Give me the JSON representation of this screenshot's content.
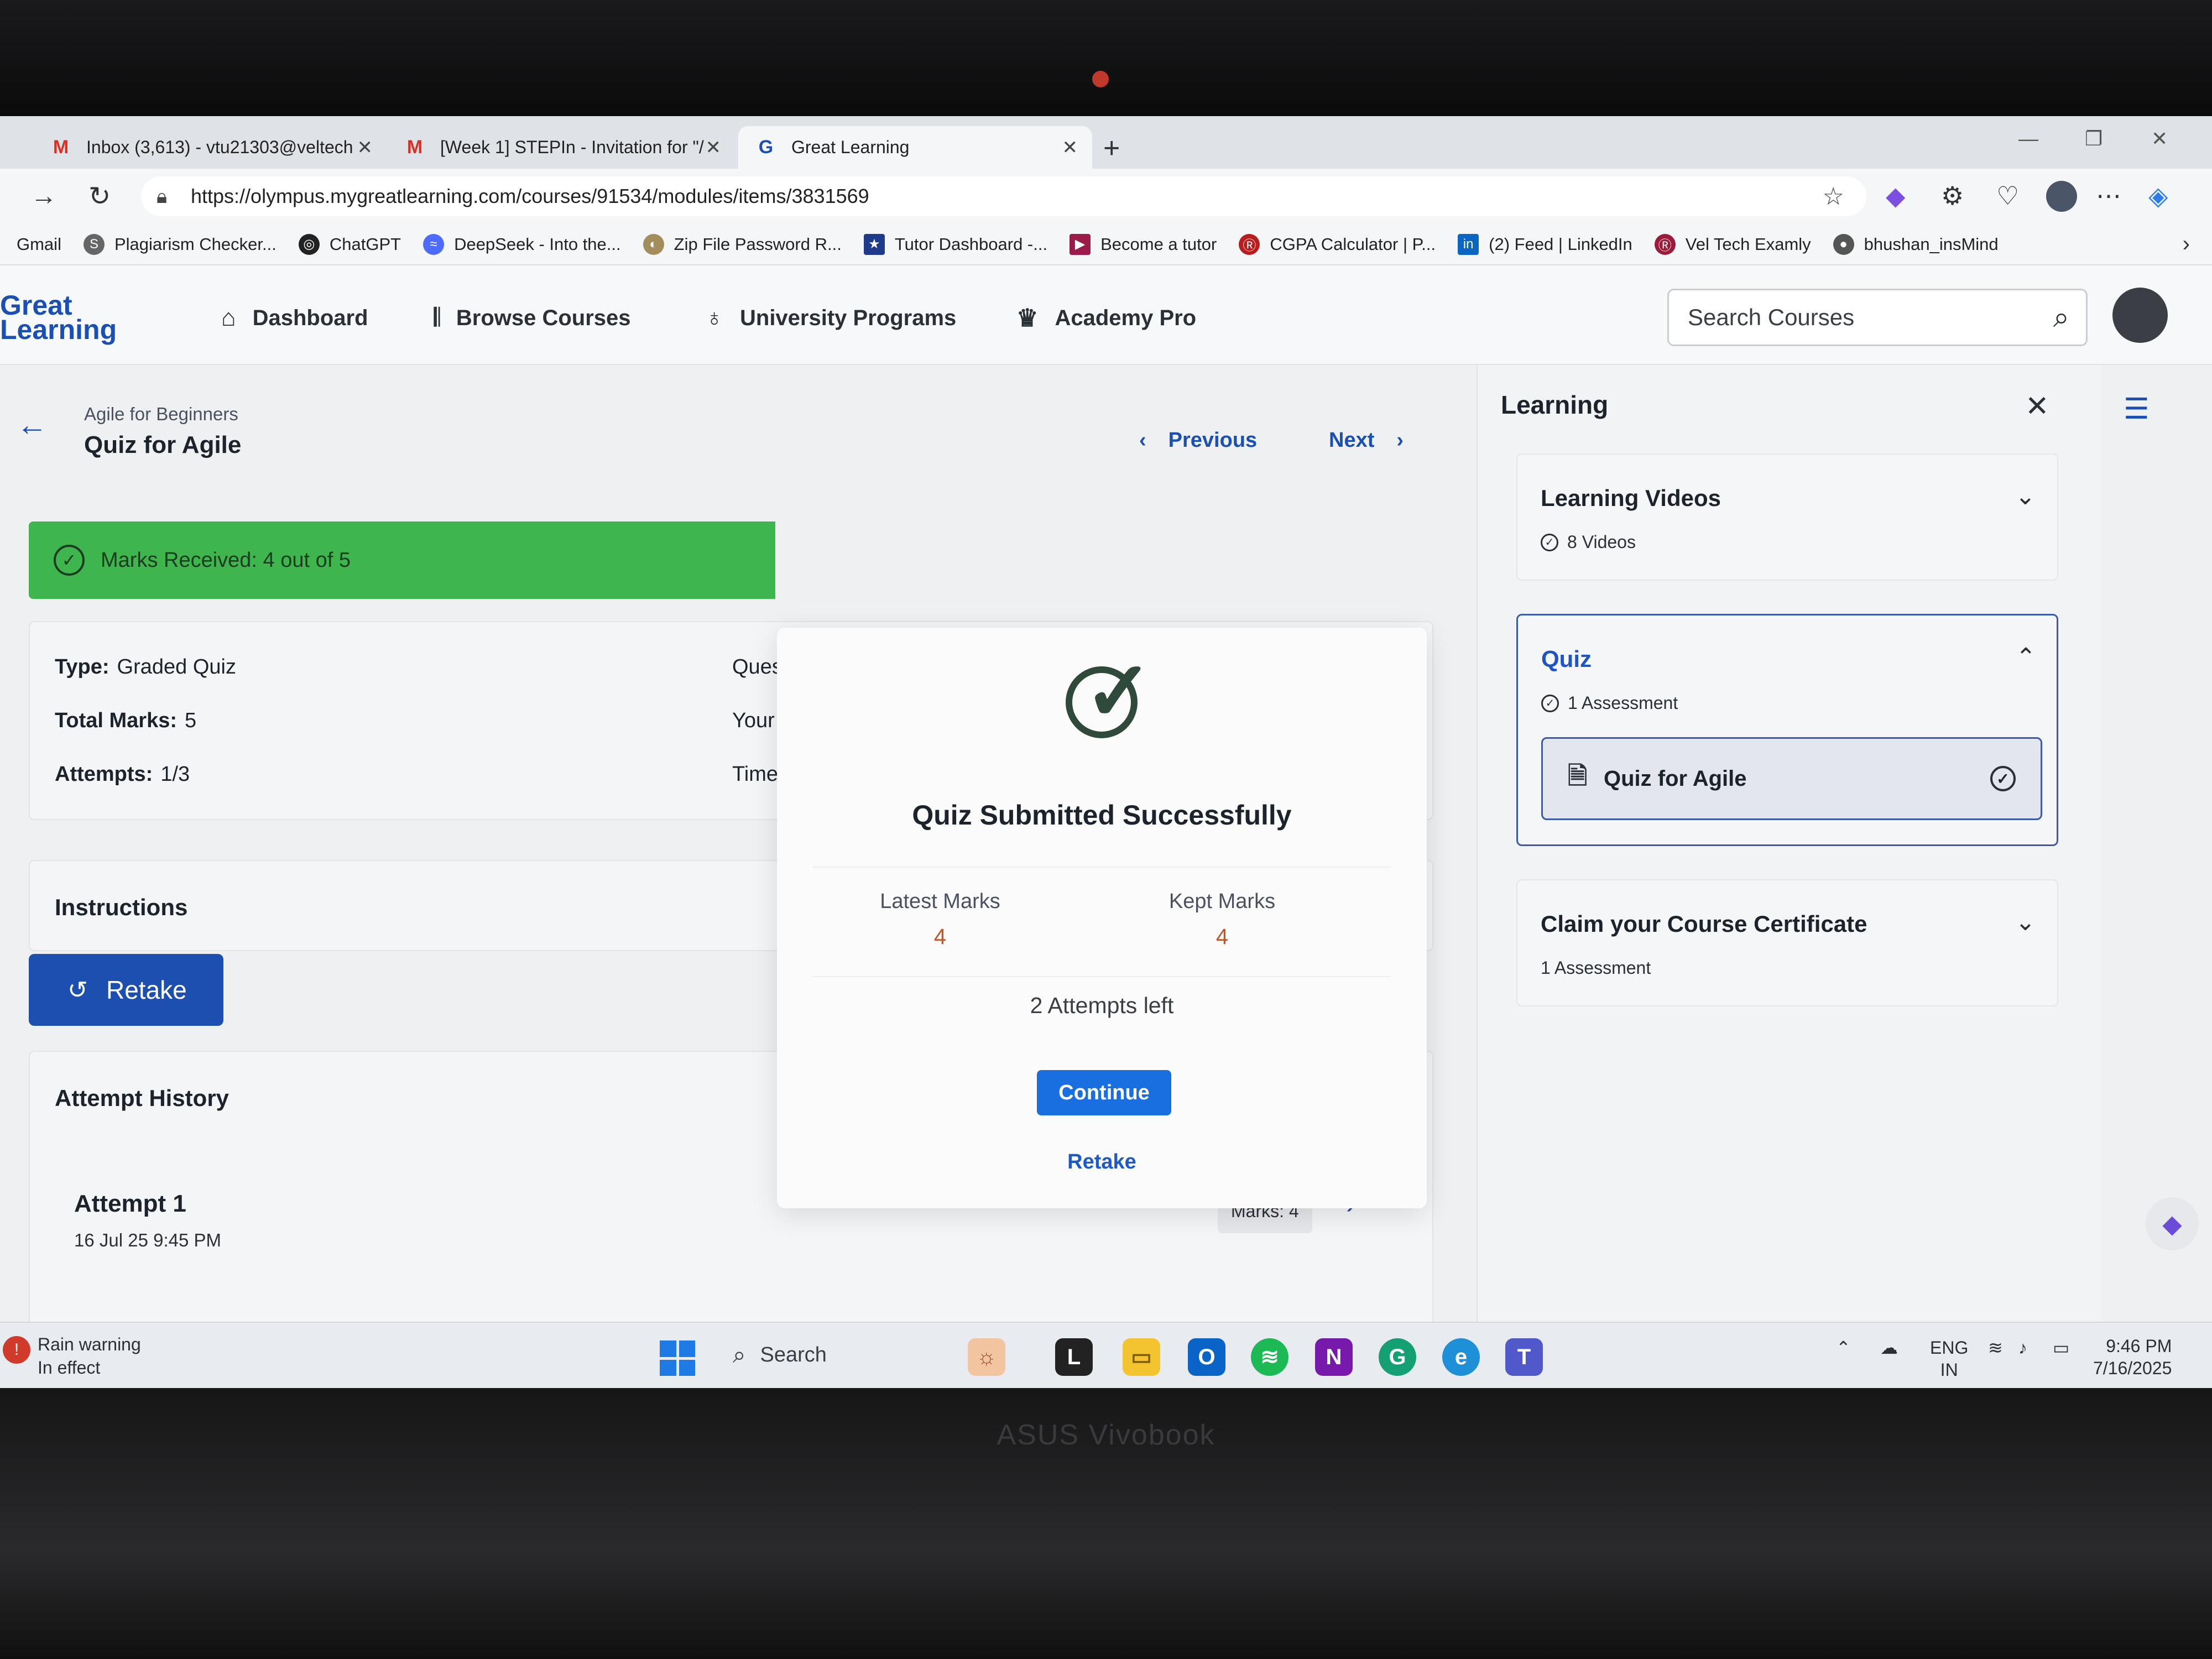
{
  "device": {
    "brand": "ASUS Vivobook"
  },
  "browser": {
    "tabs": [
      {
        "label": "Inbox (3,613) - vtu21303@veltech",
        "icon": "gmail-icon"
      },
      {
        "label": "[Week 1] STEPIn - Invitation for \"/",
        "icon": "gmail-icon"
      },
      {
        "label": "Great Learning",
        "icon": "great-learning-icon"
      }
    ],
    "url": "https://olympus.mygreatlearning.com/courses/91534/modules/items/3831569",
    "bookmarks": [
      {
        "label": "Gmail"
      },
      {
        "label": "Plagiarism Checker..."
      },
      {
        "label": "ChatGPT"
      },
      {
        "label": "DeepSeek - Into the..."
      },
      {
        "label": "Zip File Password R..."
      },
      {
        "label": "Tutor Dashboard -..."
      },
      {
        "label": "Become a tutor"
      },
      {
        "label": "CGPA Calculator | P..."
      },
      {
        "label": "(2) Feed | LinkedIn"
      },
      {
        "label": "Vel Tech Examly"
      },
      {
        "label": "bhushan_insMind"
      }
    ]
  },
  "header": {
    "logo_line1": "Great",
    "logo_line2": "Learning",
    "nav": [
      {
        "label": "Dashboard",
        "icon": "home-icon"
      },
      {
        "label": "Browse Courses",
        "icon": "library-icon"
      },
      {
        "label": "University Programs",
        "icon": "award-icon"
      },
      {
        "label": "Academy Pro",
        "icon": "crown-icon"
      }
    ],
    "search_placeholder": "Search Courses"
  },
  "main": {
    "breadcrumb": "Agile for Beginners",
    "title": "Quiz for Agile",
    "previous_label": "Previous",
    "next_label": "Next",
    "marks_banner": "Marks Received: 4 out of 5",
    "info": {
      "type_label": "Type:",
      "type_value": "Graded Quiz",
      "total_label": "Total Marks:",
      "total_value": "5",
      "attempts_label": "Attempts:",
      "attempts_value": "1/3",
      "col2_row1": "Ques",
      "col2_row2": "Your",
      "col2_row3": "Time"
    },
    "instructions_label": "Instructions",
    "retake_label": "Retake",
    "history": {
      "title": "Attempt History",
      "attempt_title": "Attempt 1",
      "attempt_date": "16 Jul 25 9:45 PM",
      "attempt_marks": "Marks: 4"
    }
  },
  "modal": {
    "title": "Quiz Submitted Successfully",
    "latest_label": "Latest Marks",
    "latest_value": "4",
    "kept_label": "Kept Marks",
    "kept_value": "4",
    "attempts_left": "2 Attempts left",
    "continue_label": "Continue",
    "retake_label": "Retake"
  },
  "sidebar": {
    "title": "Learning",
    "sections": [
      {
        "title": "Learning Videos",
        "sub": "8 Videos"
      },
      {
        "title": "Quiz",
        "sub": "1 Assessment",
        "item": "Quiz for Agile"
      },
      {
        "title": "Claim your Course Certificate",
        "sub": "1 Assessment"
      }
    ]
  },
  "taskbar": {
    "weather_line1": "Rain warning",
    "weather_line2": "In effect",
    "search_label": "Search",
    "lang_line1": "ENG",
    "lang_line2": "IN",
    "time": "9:46 PM",
    "date": "7/16/2025"
  },
  "colors": {
    "primary": "#1d4fb0",
    "success_banner": "#3fb54d",
    "marks_value": "#c0562a",
    "continue_button": "#1a6fe0"
  }
}
